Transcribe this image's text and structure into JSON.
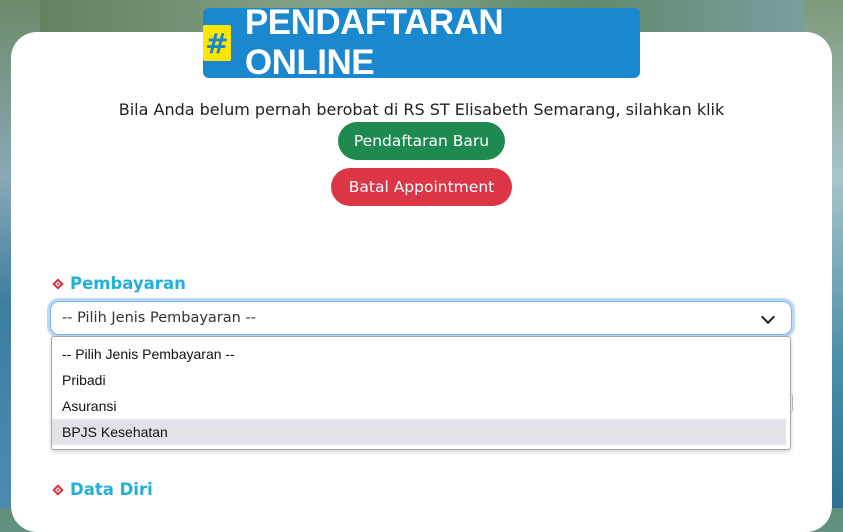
{
  "header": {
    "title_icon": "hash-icon",
    "title_icon_glyph": "#",
    "title": "PENDAFTARAN ONLINE"
  },
  "intro": {
    "text": "Bila Anda belum pernah berobat di RS ST Elisabeth Semarang, silahkan klik"
  },
  "buttons": {
    "new_registration": "Pendaftaran Baru",
    "cancel_appointment": "Batal Appointment"
  },
  "sections": {
    "payment_label": "Pembayaran",
    "personal_data_label": "Data Diri"
  },
  "payment_select": {
    "selected": "-- Pilih Jenis Pembayaran --",
    "options": [
      "-- Pilih Jenis Pembayaran --",
      "Pribadi",
      "Asuransi",
      "BPJS Kesehatan"
    ],
    "highlighted_index": 3
  },
  "colors": {
    "title_bg": "#1a87cf",
    "hash_bg": "#ffe600",
    "new_button": "#1e8a4f",
    "cancel_button": "#dc3545",
    "section_label": "#22b0d8",
    "diamond": "#d6303f"
  }
}
